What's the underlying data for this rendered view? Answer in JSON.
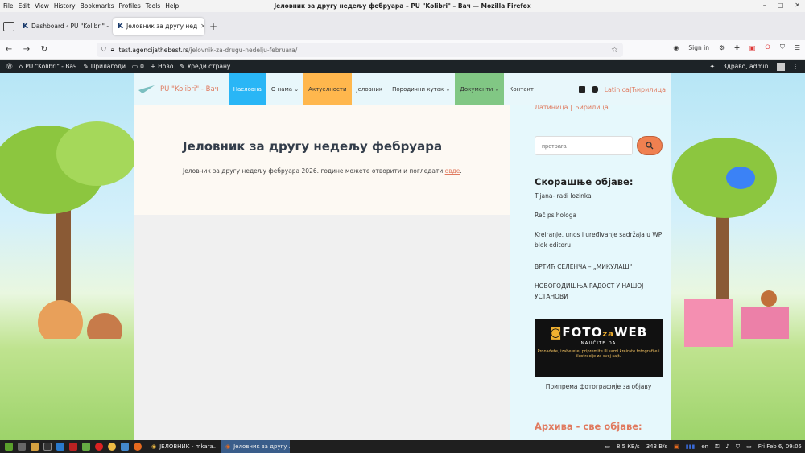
{
  "window": {
    "title": "Јеловник за другу недељу фебруара – PU \"Kolibri\" – Вач — Mozilla Firefox"
  },
  "menu": [
    "File",
    "Edit",
    "View",
    "History",
    "Bookmarks",
    "Profiles",
    "Tools",
    "Help"
  ],
  "tabs": [
    {
      "label": "Dashboard ‹ PU \"Kolibri\" - В"
    },
    {
      "label": "Јеловник за другу нед"
    }
  ],
  "address": {
    "host": "test.agencijathebest.rs",
    "path": "/jelovnik-za-drugu-nedelju-februara/"
  },
  "nav": {
    "signin": "Sign in"
  },
  "wpbar": {
    "site": "PU \"Kolibri\" - Вач",
    "customize": "Прилагоди",
    "comments": "0",
    "new": "Ново",
    "edit": "Уреди страну",
    "greeting": "Здраво, admin"
  },
  "site": {
    "name": "PU \"Kolibri\" - Вач",
    "nav": [
      "Насловна",
      "О нама",
      "Актуелности",
      "Јеловник",
      "Породични кутак",
      "Документи",
      "Контакт"
    ],
    "lang": "Latinica|Ћирилица"
  },
  "page": {
    "title": "Јеловник за другу недељу фебруара",
    "text": "Јеловник за другу недељу фебруара 2026. године можете отворити и погледати ",
    "link": "овде",
    "period": "."
  },
  "sidebar": {
    "lang": "Латиница | Ћирилица",
    "search_placeholder": "претрага",
    "recent_heading": "Скорашње објаве:",
    "posts": [
      "Tijana- radi lozinka",
      "Reč psihologa",
      "Kreiranje, unos i uređivanje sadržaja u WP blok editoru",
      "ВРТИЋ СЕЛЕНЧА – „МИКУЛАШ“",
      "НОВОГОДИШЊА РАДОСТ У НАШОЈ УСТАНОВИ"
    ],
    "banner": {
      "title_a": "FOTO",
      "title_za": "za",
      "title_b": "WEB",
      "sub": "NAUČITE DA",
      "small": "Pronađete, izaberete, pripremite ili sami kreirate fotografije i ilustracije za svoj sajt."
    },
    "banner_caption": "Припрема фотографије за објаву",
    "archive_heading": "Архива - све објаве:"
  },
  "taskbar": {
    "tasks": [
      "ЈЕЛОВНИК - mkara...",
      "Јеловник за другу ..."
    ],
    "net": "8,5 KB/s",
    "net2": "343 B/s",
    "lang": "en",
    "clock": "Fri Feb 6, 09:05"
  }
}
